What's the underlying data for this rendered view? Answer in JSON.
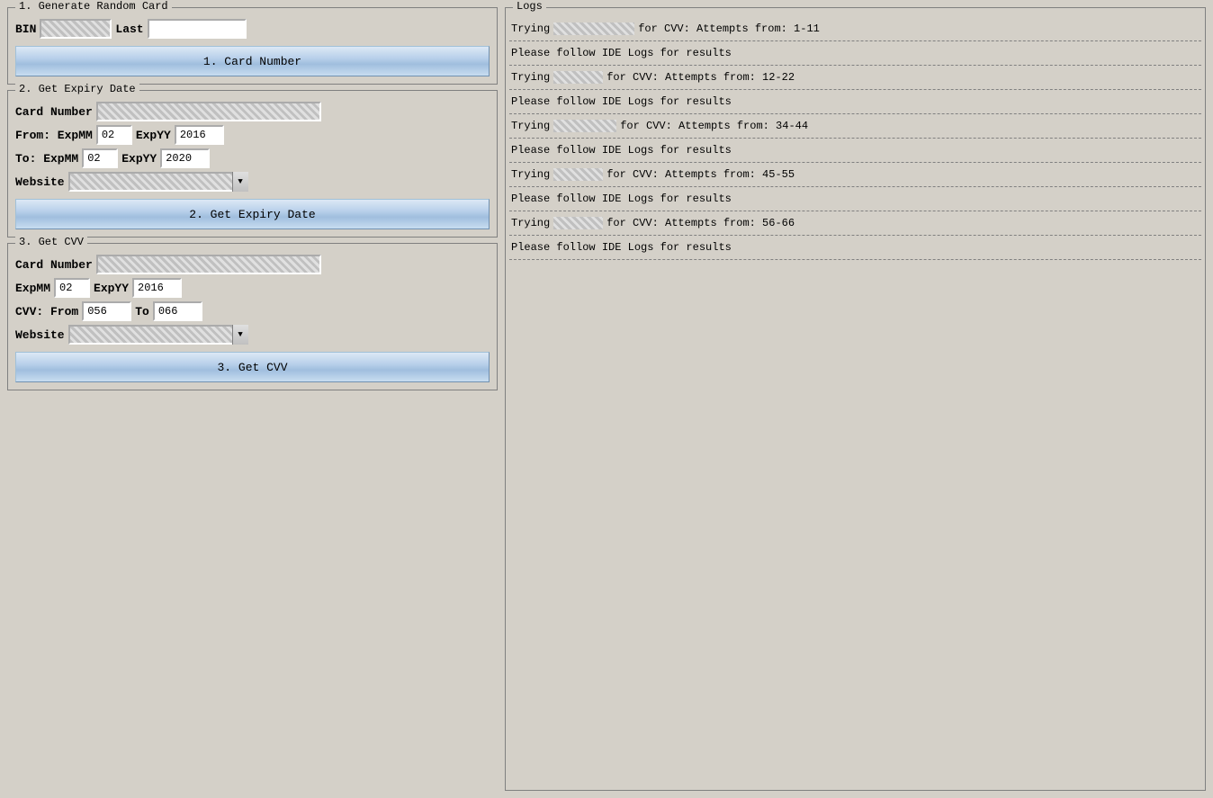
{
  "section1": {
    "legend": "1. Generate Random Card",
    "bin_label": "BIN",
    "bin_value": "47",
    "last_label": "Last",
    "last_value": "",
    "button_label": "1.        Card Number"
  },
  "section2": {
    "legend": "2. Get Expiry Date",
    "card_number_label": "Card Number",
    "card_number_value": "47",
    "from_label": "From: ExpMM",
    "from_expmm": "02",
    "from_expyy_label": "ExpYY",
    "from_expyy": "2016",
    "to_label": "To: ExpMM",
    "to_expmm": "02",
    "to_expyy_label": "ExpYY",
    "to_expyy": "2020",
    "website_label": "Website",
    "button_label": "2. Get Expiry Date"
  },
  "section3": {
    "legend": "3. Get CVV",
    "card_number_label": "Card Number",
    "card_number_value": "47",
    "expmm_label": "ExpMM",
    "expmm_value": "02",
    "expyy_label": "ExpYY",
    "expyy_value": "2016",
    "cvv_from_label": "CVV: From",
    "cvv_from_value": "056",
    "cvv_to_label": "To",
    "cvv_to_value": "066",
    "website_label": "Website",
    "button_label": "3. Get CVV"
  },
  "logs": {
    "legend": "Logs",
    "entries": [
      {
        "type": "trying",
        "text_before": "Trying",
        "masked_width": "large",
        "text_after": "for CVV: Attempts from: 1-11"
      },
      {
        "type": "divider"
      },
      {
        "type": "info",
        "text": "Please follow IDE Logs for results"
      },
      {
        "type": "divider"
      },
      {
        "type": "trying",
        "text_before": "Trying",
        "masked_width": "small",
        "text_after": "for CVV: Attempts from: 12-22"
      },
      {
        "type": "divider"
      },
      {
        "type": "info",
        "text": "Please follow IDE Logs for results"
      },
      {
        "type": "divider"
      },
      {
        "type": "trying",
        "text_before": "Trying",
        "masked_width": "medium",
        "text_after": "for CVV: Attempts from: 34-44"
      },
      {
        "type": "divider"
      },
      {
        "type": "info",
        "text": "Please follow IDE Logs for results"
      },
      {
        "type": "divider"
      },
      {
        "type": "trying",
        "text_before": "Trying",
        "masked_width": "small",
        "text_after": "for CVV: Attempts from: 45-55"
      },
      {
        "type": "divider"
      },
      {
        "type": "info",
        "text": "Please follow IDE Logs for results"
      },
      {
        "type": "divider"
      },
      {
        "type": "trying",
        "text_before": "Trying",
        "masked_width": "small",
        "text_after": "for CVV: Attempts from: 56-66"
      },
      {
        "type": "divider"
      },
      {
        "type": "info",
        "text": "Please follow IDE Logs for results"
      },
      {
        "type": "divider"
      }
    ]
  }
}
